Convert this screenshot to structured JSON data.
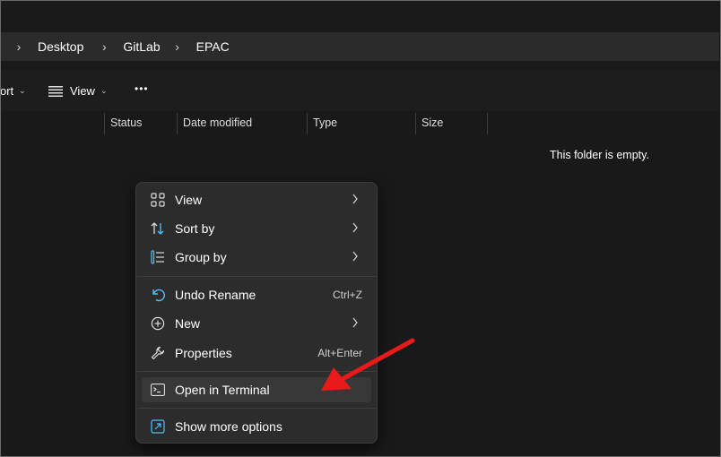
{
  "breadcrumb": {
    "items": [
      "Desktop",
      "GitLab",
      "EPAC"
    ]
  },
  "toolbar": {
    "sort_label": "ort",
    "view_label": "View",
    "more_label": "•••"
  },
  "columns": [
    "Status",
    "Date modified",
    "Type",
    "Size"
  ],
  "empty_message": "This folder is empty.",
  "context_menu": {
    "items": [
      {
        "label": "View",
        "icon": "grid-icon",
        "submenu": true
      },
      {
        "label": "Sort by",
        "icon": "sort-icon",
        "submenu": true
      },
      {
        "label": "Group by",
        "icon": "group-icon",
        "submenu": true
      },
      {
        "label": "Undo Rename",
        "icon": "undo-icon",
        "shortcut": "Ctrl+Z"
      },
      {
        "label": "New",
        "icon": "new-icon",
        "submenu": true
      },
      {
        "label": "Properties",
        "icon": "wrench-icon",
        "shortcut": "Alt+Enter"
      },
      {
        "label": "Open in Terminal",
        "icon": "terminal-icon",
        "highlighted": true
      },
      {
        "label": "Show more options",
        "icon": "expand-icon"
      }
    ]
  },
  "colors": {
    "background": "#191919",
    "menu_bg": "#2c2c2c",
    "accent_blue": "#4cc2ff",
    "annotation_red": "#e81a1a"
  }
}
